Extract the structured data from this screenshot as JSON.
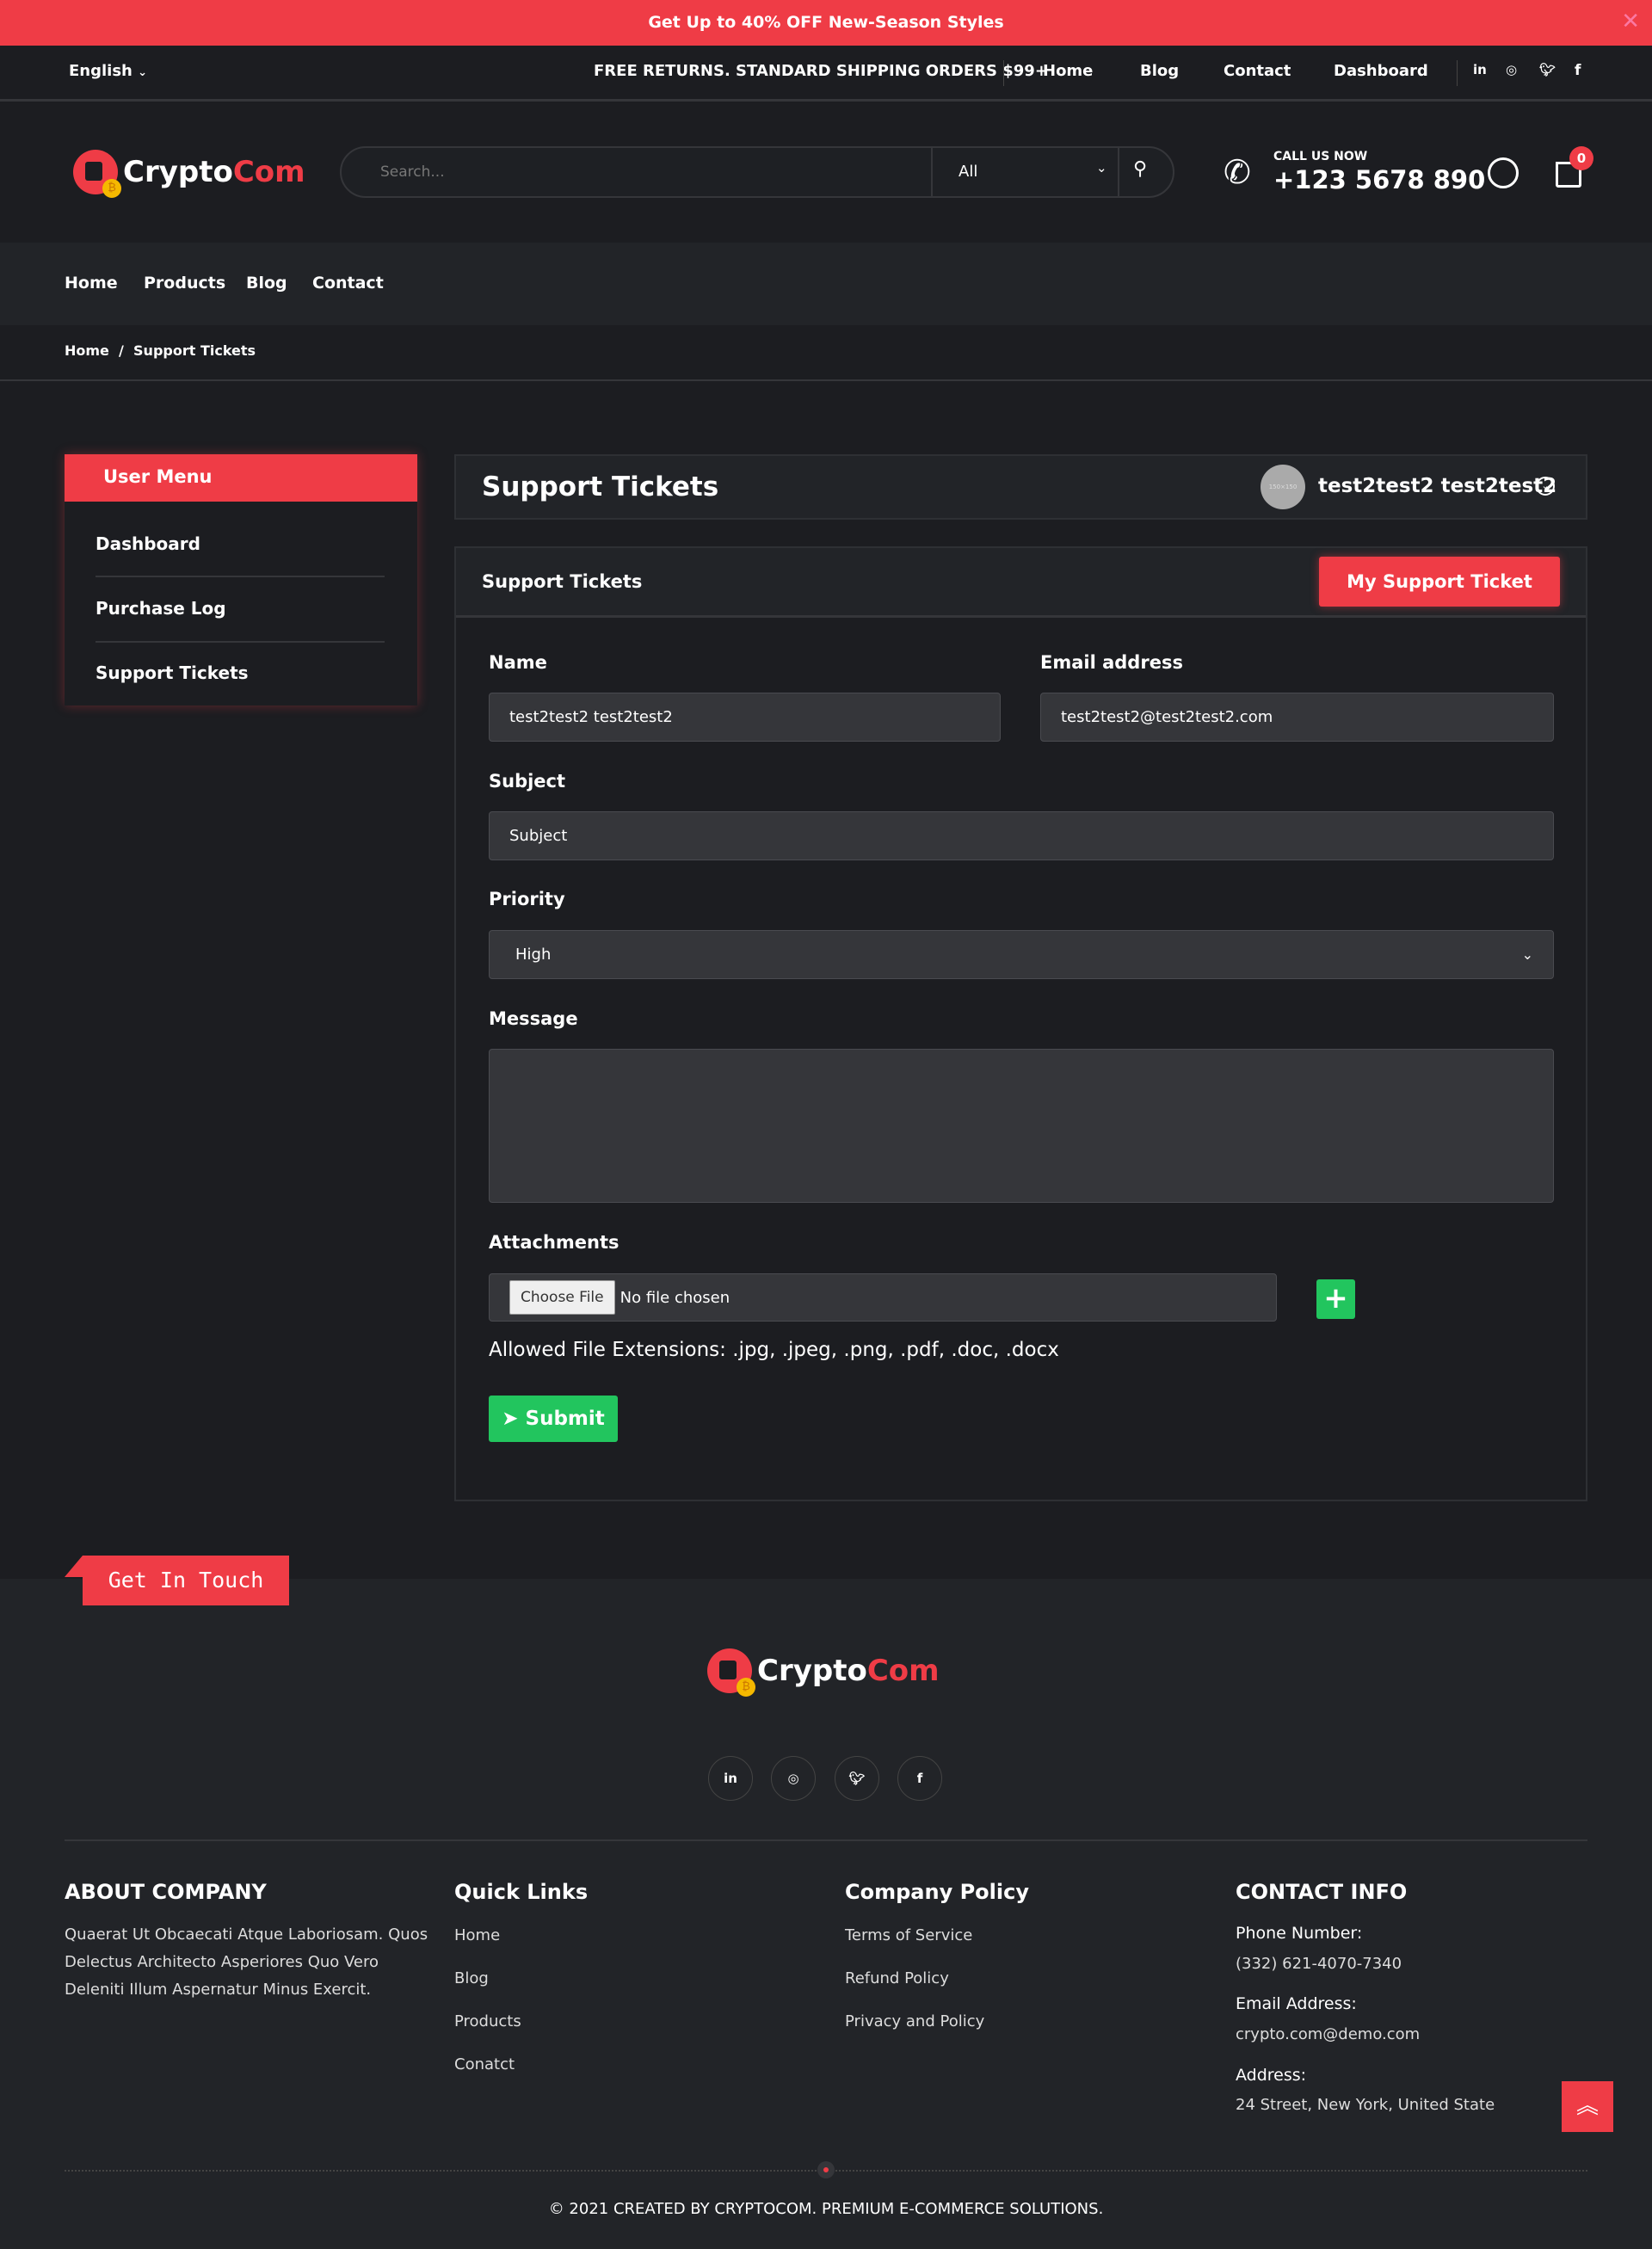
{
  "banner": {
    "text": "Get Up to 40% OFF New-Season Styles"
  },
  "topbar": {
    "language": "English",
    "promo": "FREE RETURNS. STANDARD SHIPPING ORDERS $99+",
    "links": [
      "Home",
      "Blog",
      "Contact",
      "Dashboard"
    ],
    "social": [
      "linkedin-icon",
      "instagram-icon",
      "twitter-icon",
      "facebook-icon"
    ]
  },
  "header": {
    "logo_main": "Crypto",
    "logo_accent": "Com",
    "search_placeholder": "Search...",
    "category": "All",
    "call_label": "CALL US NOW",
    "phone": "+123 5678 890",
    "cart_count": "0"
  },
  "nav": [
    "Home",
    "Products",
    "Blog",
    "Contact"
  ],
  "breadcrumb": {
    "home": "Home",
    "sep": "/",
    "current": "Support Tickets"
  },
  "sidebar": {
    "title": "User Menu",
    "items": [
      "Dashboard",
      "Purchase Log",
      "Support Tickets"
    ]
  },
  "page": {
    "title": "Support Tickets",
    "user_name": "test2test2 test2test2",
    "avatar_text": "150×150"
  },
  "form": {
    "title": "Support Tickets",
    "my_ticket_button": "My Support Ticket",
    "name_label": "Name",
    "name_value": "test2test2 test2test2",
    "email_label": "Email address",
    "email_value": "test2test2@test2test2.com",
    "subject_label": "Subject",
    "subject_placeholder": "Subject",
    "priority_label": "Priority",
    "priority_value": "High",
    "message_label": "Message",
    "attachments_label": "Attachments",
    "choose_file": "Choose File",
    "no_file": "No file chosen",
    "allowed": "Allowed File Extensions: .jpg, .jpeg, .png, .pdf, .doc, .docx",
    "submit": "Submit"
  },
  "footer": {
    "tab": "Get In Touch",
    "about_title": "ABOUT COMPANY",
    "about_lines": [
      "Quaerat Ut Obcaecati Atque Laboriosam. Quos",
      "Delectus Architecto Asperiores Quo Vero",
      "Deleniti Illum Aspernatur Minus Exercit."
    ],
    "quick_title": "Quick Links",
    "quick_links": [
      "Home",
      "Blog",
      "Products",
      "Conatct"
    ],
    "policy_title": "Company Policy",
    "policy_links": [
      "Terms of Service",
      "Refund Policy",
      "Privacy and Policy"
    ],
    "contact_title": "CONTACT INFO",
    "phone_label": "Phone Number:",
    "phone": "(332) 621-4070-7340",
    "email_label": "Email Address:",
    "email": "crypto.com@demo.com",
    "address_label": "Address:",
    "address": "24 Street, New York, United State",
    "copyright": "© 2021 CREATED BY CRYPTOCOM. PREMIUM E-COMMERCE SOLUTIONS."
  },
  "colors": {
    "accent": "#ef3c46",
    "success": "#22c55e",
    "bg": "#1c1d21",
    "panel": "#222428"
  }
}
